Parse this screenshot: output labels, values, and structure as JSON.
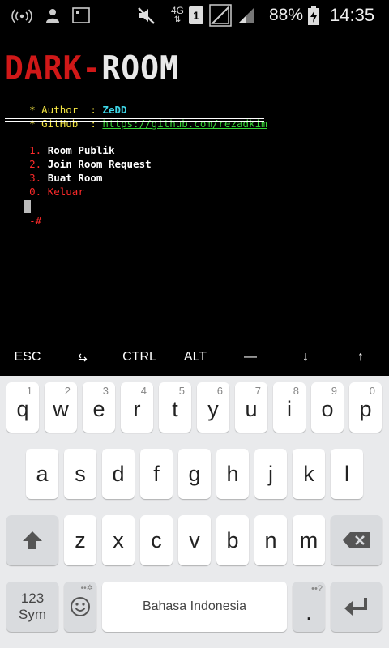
{
  "status_bar": {
    "network_type": "4G",
    "sim_slot": "1",
    "battery_percent": "88%",
    "time": "14:35",
    "icons": [
      "wifi-hotspot-icon",
      "user-icon",
      "screenshot-icon",
      "mute-icon",
      "network-icon",
      "sim-icon",
      "signal-empty-icon",
      "signal-icon",
      "battery-charging-icon"
    ]
  },
  "terminal": {
    "banner_part1": "DARK-",
    "banner_part2": "ROOM",
    "author_label": "* Author  : ",
    "author_value": "ZeDD",
    "github_label": "* GitHub  : ",
    "github_value": "https://github.com/rezadkim",
    "menu": [
      {
        "num": "1.",
        "label": "Room Publik"
      },
      {
        "num": "2.",
        "label": "Join Room Request"
      },
      {
        "num": "3.",
        "label": "Buat Room"
      },
      {
        "num": "0.",
        "label": "Keluar"
      }
    ],
    "prompt": "-#",
    "colors": {
      "accent_red": "#ff2a2a",
      "yellow": "#f5e642",
      "cyan": "#3fd7e8",
      "green": "#38d838"
    }
  },
  "extra_keys": [
    "ESC",
    "⇆",
    "CTRL",
    "ALT",
    "—",
    "↓",
    "↑"
  ],
  "keyboard": {
    "row1": [
      {
        "key": "q",
        "hint": "1"
      },
      {
        "key": "w",
        "hint": "2"
      },
      {
        "key": "e",
        "hint": "3"
      },
      {
        "key": "r",
        "hint": "4"
      },
      {
        "key": "t",
        "hint": "5"
      },
      {
        "key": "y",
        "hint": "6"
      },
      {
        "key": "u",
        "hint": "7"
      },
      {
        "key": "i",
        "hint": "8"
      },
      {
        "key": "o",
        "hint": "9"
      },
      {
        "key": "p",
        "hint": "0"
      }
    ],
    "row2": [
      "a",
      "s",
      "d",
      "f",
      "g",
      "h",
      "j",
      "k",
      "l"
    ],
    "row3": [
      "z",
      "x",
      "c",
      "v",
      "b",
      "n",
      "m"
    ],
    "symbols_label_1": "123",
    "symbols_label_2": "Sym",
    "space_label": "Bahasa Indonesia",
    "period_label": ".",
    "period_hint": "••?",
    "emoji_hint": "••✲"
  }
}
